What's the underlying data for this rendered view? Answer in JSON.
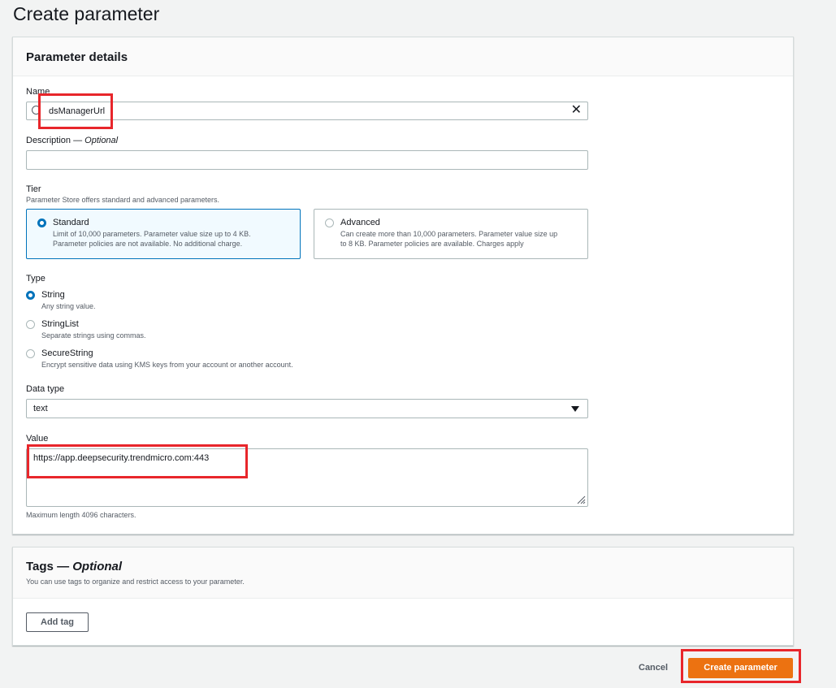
{
  "page": {
    "title": "Create parameter"
  },
  "details": {
    "title": "Parameter details",
    "name": {
      "label": "Name",
      "value": "dsManagerUrl"
    },
    "description": {
      "label": "Description — ",
      "optional": "Optional",
      "value": ""
    },
    "tier": {
      "label": "Tier",
      "helper": "Parameter Store offers standard and advanced parameters.",
      "options": [
        {
          "title": "Standard",
          "desc1": "Limit of 10,000 parameters. Parameter value size up to 4 KB.",
          "desc2": "Parameter policies are not available. No additional charge.",
          "selected": true
        },
        {
          "title": "Advanced",
          "desc1": "Can create more than 10,000 parameters. Parameter value size up",
          "desc2": "to 8 KB. Parameter policies are available. Charges apply",
          "selected": false
        }
      ]
    },
    "type": {
      "label": "Type",
      "options": [
        {
          "title": "String",
          "desc": "Any string value.",
          "selected": true
        },
        {
          "title": "StringList",
          "desc": "Separate strings using commas.",
          "selected": false
        },
        {
          "title": "SecureString",
          "desc": "Encrypt sensitive data using KMS keys from your account or another account.",
          "selected": false
        }
      ]
    },
    "data_type": {
      "label": "Data type",
      "value": "text"
    },
    "value": {
      "label": "Value",
      "value": "https://app.deepsecurity.trendmicro.com:443",
      "helper": "Maximum length 4096 characters."
    }
  },
  "tags": {
    "title": "Tags — ",
    "optional": "Optional",
    "helper": "You can use tags to organize and restrict access to your parameter.",
    "add_label": "Add tag"
  },
  "footer": {
    "cancel_label": "Cancel",
    "create_label": "Create parameter"
  },
  "colors": {
    "accent": "#0073bb",
    "primary": "#ec7211",
    "highlight": "#e8262b"
  }
}
